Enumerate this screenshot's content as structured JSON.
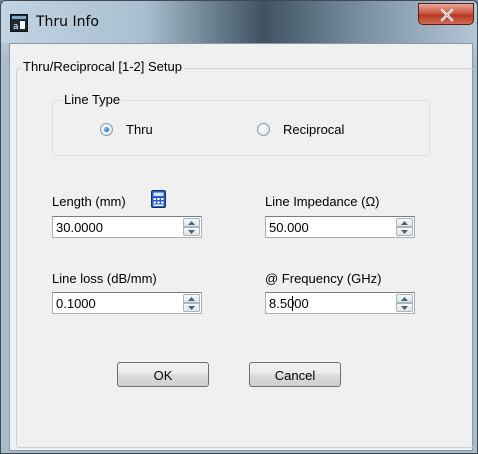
{
  "window": {
    "title": "Thru Info",
    "close_icon": "close-icon",
    "app_icon": "dialog-app-icon"
  },
  "setup_group": {
    "label": "Thru/Reciprocal [1-2] Setup"
  },
  "line_type": {
    "label": "Line Type",
    "options": [
      {
        "label": "Thru",
        "selected": true
      },
      {
        "label": "Reciprocal",
        "selected": false
      }
    ]
  },
  "fields": {
    "length": {
      "label": "Length (mm)",
      "value": "30.0000",
      "icon": "calculator-icon"
    },
    "impedance": {
      "label": "Line Impedance (Ω)",
      "value": "50.000"
    },
    "line_loss": {
      "label": "Line loss (dB/mm)",
      "value": "0.1000"
    },
    "frequency": {
      "label": "@ Frequency (GHz)",
      "value": "8.5000"
    }
  },
  "buttons": {
    "ok": "OK",
    "cancel": "Cancel"
  },
  "colors": {
    "titlebar_dark": "#3f5361",
    "close_button": "#cf5a45",
    "dialog_bg": "#f0f0f0",
    "radio_accent": "#2b7bc4"
  }
}
